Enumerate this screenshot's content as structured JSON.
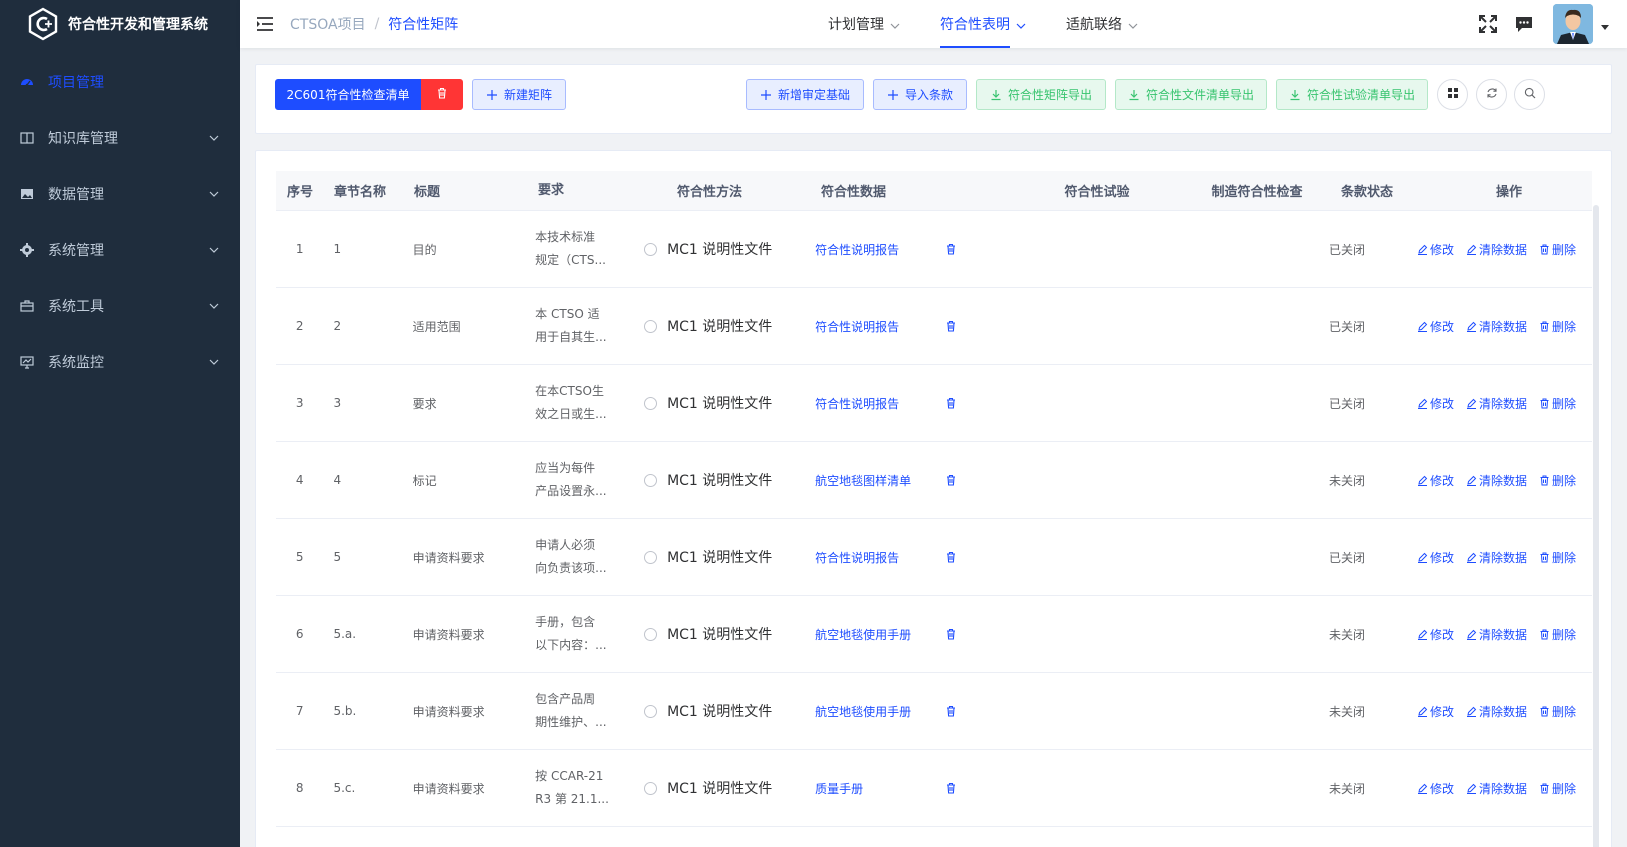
{
  "app": {
    "title": "符合性开发和管理系统"
  },
  "sidebar": {
    "items": [
      {
        "label": "项目管理",
        "icon": "dashboard-icon",
        "active": true
      },
      {
        "label": "知识库管理",
        "icon": "book-icon"
      },
      {
        "label": "数据管理",
        "icon": "image-icon"
      },
      {
        "label": "系统管理",
        "icon": "gear-icon"
      },
      {
        "label": "系统工具",
        "icon": "toolbox-icon"
      },
      {
        "label": "系统监控",
        "icon": "monitor-icon"
      }
    ]
  },
  "breadcrumb": {
    "parent": "CTSOA项目",
    "separator": "/",
    "current": "符合性矩阵"
  },
  "topnav": {
    "items": [
      {
        "label": "计划管理"
      },
      {
        "label": "符合性表明",
        "active": true
      },
      {
        "label": "适航联络"
      }
    ]
  },
  "toolbar": {
    "checklist_label": "2C601符合性检查清单",
    "new_matrix_label": "新建矩阵",
    "add_basis_label": "新增审定基础",
    "import_label": "导入条款",
    "export_matrix_label": "符合性矩阵导出",
    "export_docs_label": "符合性文件清单导出",
    "export_tests_label": "符合性试验清单导出"
  },
  "table": {
    "headers": {
      "idx": "序号",
      "chapter": "章节名称",
      "title": "标题",
      "requirement": "要求",
      "method": "符合性方法",
      "data": "符合性数据",
      "test": "符合性试验",
      "mfg": "制造符合性检查",
      "status": "条款状态",
      "ops": "操作"
    },
    "ops": {
      "edit": "修改",
      "clear": "清除数据",
      "delete": "删除"
    },
    "rows": [
      {
        "idx": "1",
        "chapter": "1",
        "title": "目的",
        "req1": "本技术标准",
        "req2": "规定（CTS...",
        "method": "MC1 说明性文件",
        "data": "符合性说明报告",
        "status": "已关闭"
      },
      {
        "idx": "2",
        "chapter": "2",
        "title": "适用范围",
        "req1": "本 CTSO 适",
        "req2": "用于自其生...",
        "method": "MC1 说明性文件",
        "data": "符合性说明报告",
        "status": "已关闭"
      },
      {
        "idx": "3",
        "chapter": "3",
        "title": "要求",
        "req1": "在本CTSO生",
        "req2": "效之日或生...",
        "method": "MC1 说明性文件",
        "data": "符合性说明报告",
        "status": "已关闭"
      },
      {
        "idx": "4",
        "chapter": "4",
        "title": "标记",
        "req1": "应当为每件",
        "req2": "产品设置永...",
        "method": "MC1 说明性文件",
        "data": "航空地毯图样清单",
        "status": "未关闭"
      },
      {
        "idx": "5",
        "chapter": "5",
        "title": "申请资料要求",
        "req1": "申请人必须",
        "req2": "向负责该项...",
        "method": "MC1 说明性文件",
        "data": "符合性说明报告",
        "status": "已关闭"
      },
      {
        "idx": "6",
        "chapter": "5.a.",
        "title": "申请资料要求",
        "req1": "手册，包含",
        "req2": "以下内容：...",
        "method": "MC1 说明性文件",
        "data": "航空地毯使用手册",
        "status": "未关闭"
      },
      {
        "idx": "7",
        "chapter": "5.b.",
        "title": "申请资料要求",
        "req1": "包含产品周",
        "req2": "期性维护、...",
        "method": "MC1 说明性文件",
        "data": "航空地毯使用手册",
        "status": "未关闭"
      },
      {
        "idx": "8",
        "chapter": "5.c.",
        "title": "申请资料要求",
        "req1": "按 CCAR-21",
        "req2": "R3 第 21.1...",
        "method": "MC1 说明性文件",
        "data": "质量手册",
        "status": "未关闭"
      }
    ]
  },
  "colors": {
    "sidebar_bg": "#1f2d3d",
    "accent": "#1e4dff",
    "danger": "#ff3535",
    "success": "#38c46f"
  }
}
